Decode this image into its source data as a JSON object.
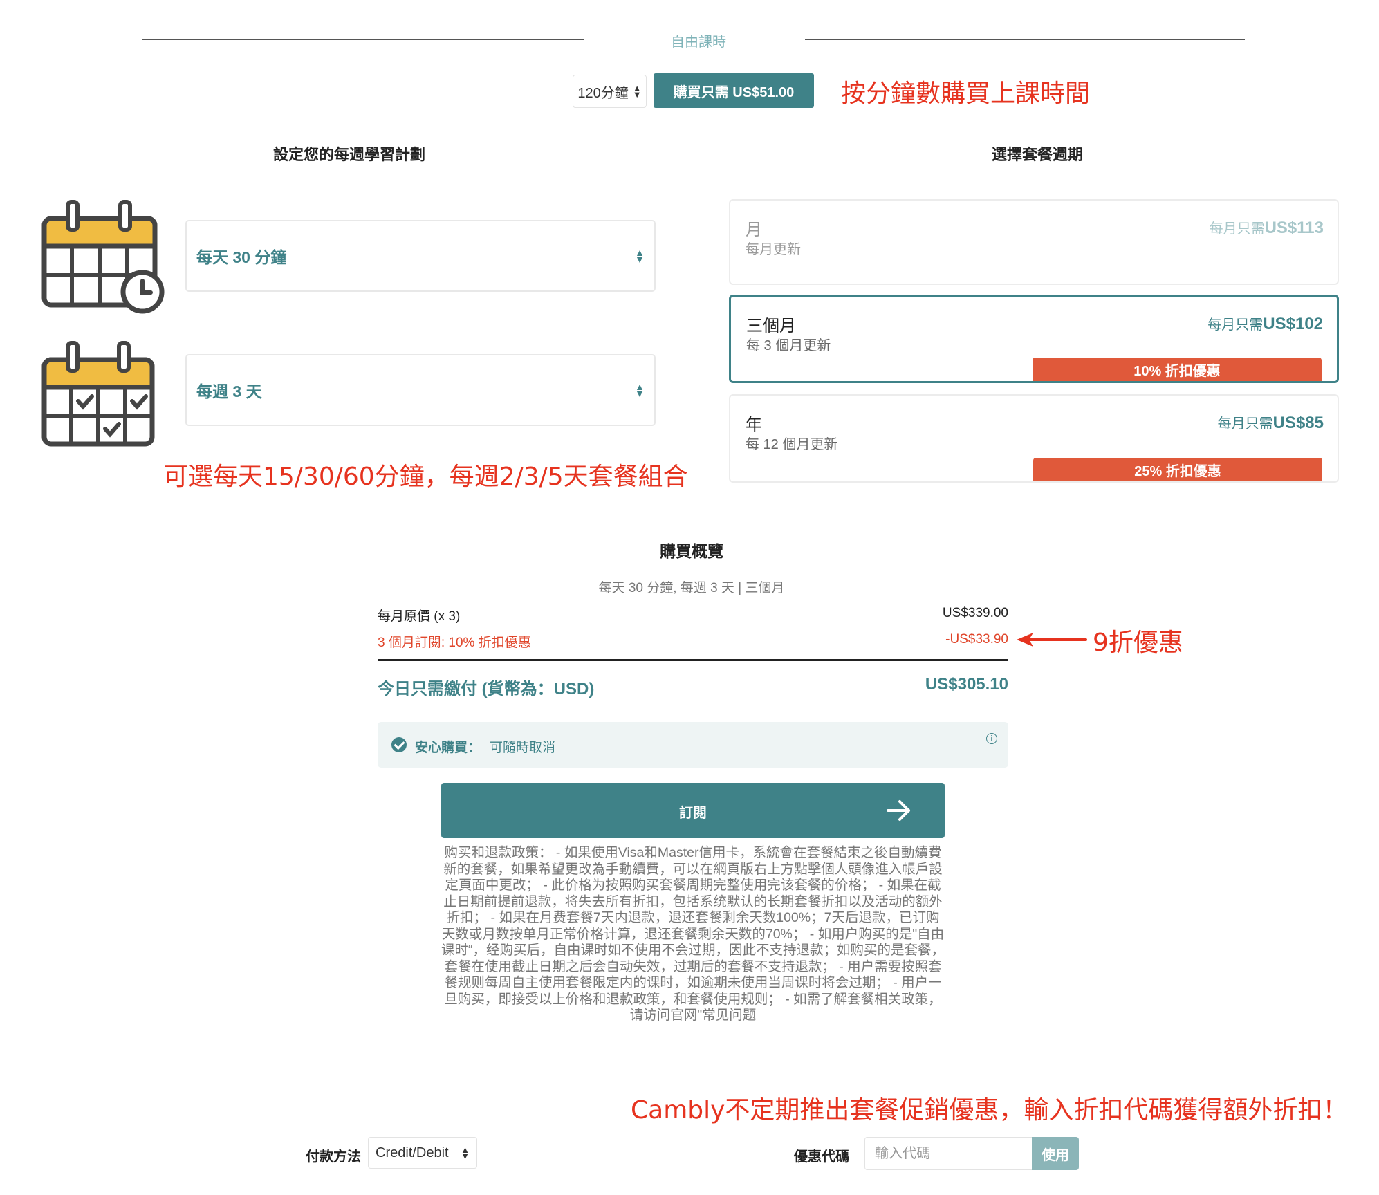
{
  "free_time": {
    "title": "自由課時",
    "minutes_value": "120分鐘",
    "buy_label": "購買只需 US$51.00",
    "note": "按分鐘數購買上課時間"
  },
  "weekly_plan": {
    "heading": "設定您的每週學習計劃",
    "minutes_per_day": "每天 30 分鐘",
    "days_per_week": "每週 3 天",
    "note": "可選每天15/30/60分鐘，每週2/3/5天套餐組合"
  },
  "package_cycle": {
    "heading": "選擇套餐週期",
    "packages": [
      {
        "name": "月",
        "renew": "每月更新",
        "price_prefix": "每月只需",
        "price": "US$113",
        "badge": ""
      },
      {
        "name": "三個月",
        "renew": "每 3 個月更新",
        "price_prefix": "每月只需",
        "price": "US$102",
        "badge": "10% 折扣優惠"
      },
      {
        "name": "年",
        "renew": "每 12 個月更新",
        "price_prefix": "每月只需",
        "price": "US$85",
        "badge": "25% 折扣優惠"
      }
    ],
    "selected_index": 1
  },
  "summary": {
    "title": "購買概覽",
    "subtitle": "每天 30 分鐘, 每週 3 天 | 三個月",
    "original_label": "每月原價 (x 3)",
    "original_value": "US$339.00",
    "discount_label": "3 個月訂閱: 10% 折扣優惠",
    "discount_value": "-US$33.90",
    "discount_note": "9折優惠",
    "total_label": "今日只需繳付 (貨幣為：USD)",
    "total_value": "US$305.10"
  },
  "safe_purchase": {
    "label": "安心購買：",
    "text": "可隨時取消"
  },
  "subscribe_label": "訂閱",
  "policy_text": "购买和退款政策： - 如果使用Visa和Master信用卡，系統會在套餐結束之後自動續費新的套餐，如果希望更改為手動續費，可以在網頁版右上方點擊個人頭像進入帳戶設定頁面中更改； - 此价格为按照购买套餐周期完整使用完该套餐的价格； - 如果在截止日期前提前退款，将失去所有折扣，包括系统默认的长期套餐折扣以及活动的额外折扣； - 如果在月费套餐7天内退款，退还套餐剩余天数100%；7天后退款，已订购天数或月数按单月正常价格计算，退还套餐剩余天数的70%； - 如用户购买的是\"自由课时“，经购买后，自由课时如不使用不会过期，因此不支持退款；如购买的是套餐，套餐在使用截止日期之后会自动失效，过期后的套餐不支持退款； - 用户需要按照套餐规则每周自主使用套餐限定内的课时，如逾期未使用当周课时将会过期； - 用户一旦购买，即接受以上价格和退款政策，和套餐使用规则； - 如需了解套餐相关政策，请访问官网\"常见问题",
  "promo_note": "Cambly不定期推出套餐促銷優惠，輸入折扣代碼獲得額外折扣！",
  "payment": {
    "label": "付款方法",
    "method": "Credit/Debit"
  },
  "coupon": {
    "label": "優惠代碼",
    "placeholder": "輸入代碼",
    "apply_label": "使用"
  },
  "colors": {
    "primary": "#3f8288",
    "discount_badge": "#e0593a",
    "annotation": "#e6331f",
    "calendar_yellow": "#f0bc42"
  }
}
